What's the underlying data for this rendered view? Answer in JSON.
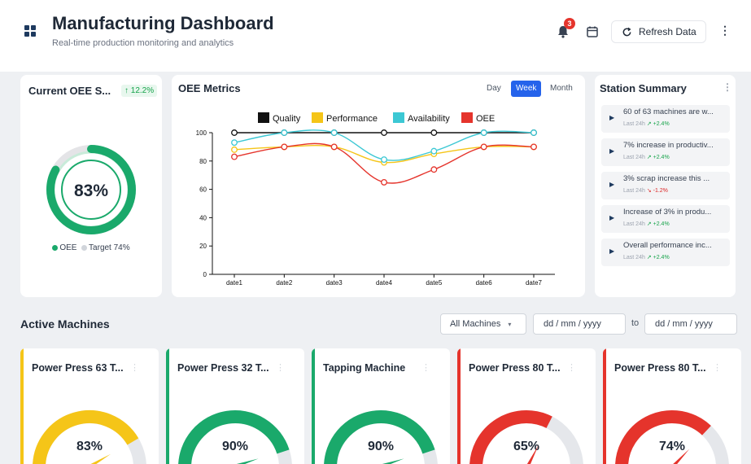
{
  "header": {
    "title": "Manufacturing Dashboard",
    "subtitle": "Real-time production monitoring and analytics",
    "notification_count": "3",
    "refresh_label": "Refresh Data"
  },
  "oee_card": {
    "title": "Current OEE S...",
    "change": "↑ 12.2%",
    "value_label": "83%",
    "value": 83,
    "target": 74,
    "legend_oee": "OEE",
    "legend_target": "Target 74%"
  },
  "metrics": {
    "title": "OEE Metrics",
    "ranges": [
      "Day",
      "Week",
      "Month"
    ],
    "active_range": "Week"
  },
  "chart_data": {
    "type": "line",
    "x": [
      "date1",
      "date2",
      "date3",
      "date4",
      "date5",
      "date6",
      "date7"
    ],
    "ylim": [
      0,
      100
    ],
    "yticks": [
      0,
      20,
      40,
      60,
      80,
      100
    ],
    "legend_position": "top",
    "series": [
      {
        "name": "Quality",
        "color": "#111111",
        "values": [
          100,
          100,
          100,
          100,
          100,
          100,
          100
        ]
      },
      {
        "name": "Performance",
        "color": "#f5c518",
        "values": [
          88,
          90,
          90,
          79,
          85,
          90,
          90
        ]
      },
      {
        "name": "Availability",
        "color": "#3cc8d4",
        "values": [
          93,
          100,
          100,
          81,
          87,
          100,
          100
        ]
      },
      {
        "name": "OEE",
        "color": "#e5342c",
        "values": [
          83,
          90,
          90,
          65,
          74,
          90,
          90
        ]
      }
    ]
  },
  "station": {
    "title": "Station Summary",
    "items": [
      {
        "text": "60 of 63 machines are w...",
        "period": "Last 24h",
        "trend": "↗ +2.4%",
        "dir": "up"
      },
      {
        "text": "7% increase in productiv...",
        "period": "Last 24h",
        "trend": "↗ +2.4%",
        "dir": "up"
      },
      {
        "text": "3% scrap increase this ...",
        "period": "Last 24h",
        "trend": "↘ -1.2%",
        "dir": "down"
      },
      {
        "text": "Increase of 3% in produ...",
        "period": "Last 24h",
        "trend": "↗ +2.4%",
        "dir": "up"
      },
      {
        "text": "Overall performance inc...",
        "period": "Last 24h",
        "trend": "↗ +2.4%",
        "dir": "up"
      }
    ]
  },
  "active": {
    "title": "Active Machines",
    "filter": "All Machines",
    "date_from_placeholder": "dd / mm / yyyy",
    "to_label": "to",
    "date_to_placeholder": "dd / mm / yyyy"
  },
  "machines": [
    {
      "name": "Power Press 63 T...",
      "value": 83,
      "label": "83%",
      "color": "#f5c518"
    },
    {
      "name": "Power Press 32 T...",
      "value": 90,
      "label": "90%",
      "color": "#1aa96b"
    },
    {
      "name": "Tapping Machine",
      "value": 90,
      "label": "90%",
      "color": "#1aa96b"
    },
    {
      "name": "Power Press 80 T...",
      "value": 65,
      "label": "65%",
      "color": "#e5342c"
    },
    {
      "name": "Power Press 80 T...",
      "value": 74,
      "label": "74%",
      "color": "#e5342c"
    }
  ]
}
